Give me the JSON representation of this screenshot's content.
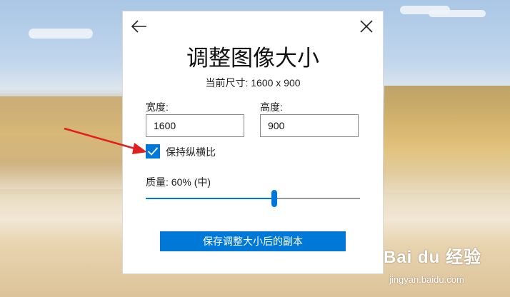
{
  "dialog": {
    "title": "调整图像大小",
    "current_size": "当前尺寸: 1600 x 900",
    "width_label": "宽度:",
    "width_value": "1600",
    "height_label": "高度:",
    "height_value": "900",
    "keep_ratio_label": "保持纵横比",
    "keep_ratio_checked": true,
    "quality_label": "质量: 60% (中)",
    "quality_value": 0.6,
    "save_button": "保存调整大小后的副本"
  },
  "watermark": {
    "logo_text": "Bai du 经验",
    "url_text": "jingyan.baidu.com"
  },
  "colors": {
    "accent": "#0078d7",
    "annotation_arrow": "#e02020"
  },
  "icons": {
    "back": "arrow-left-icon",
    "close": "close-icon",
    "check": "checkmark-icon"
  }
}
